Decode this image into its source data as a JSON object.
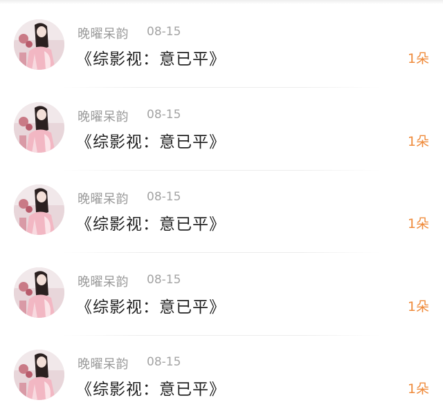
{
  "colors": {
    "username": "#9a9a9a",
    "date": "#a3a3a3",
    "title": "#222222",
    "count_accent": "#ef8a3a"
  },
  "items": [
    {
      "username": "晚曜呆韵",
      "date": "08-15",
      "title": "《综影视：意已平》",
      "count": "1朵",
      "avatar_icon": "user-avatar-photo"
    },
    {
      "username": "晚曜呆韵",
      "date": "08-15",
      "title": "《综影视：意已平》",
      "count": "1朵",
      "avatar_icon": "user-avatar-photo"
    },
    {
      "username": "晚曜呆韵",
      "date": "08-15",
      "title": "《综影视：意已平》",
      "count": "1朵",
      "avatar_icon": "user-avatar-photo"
    },
    {
      "username": "晚曜呆韵",
      "date": "08-15",
      "title": "《综影视：意已平》",
      "count": "1朵",
      "avatar_icon": "user-avatar-photo"
    },
    {
      "username": "晚曜呆韵",
      "date": "08-15",
      "title": "《综影视：意已平》",
      "count": "1朵",
      "avatar_icon": "user-avatar-photo"
    }
  ]
}
